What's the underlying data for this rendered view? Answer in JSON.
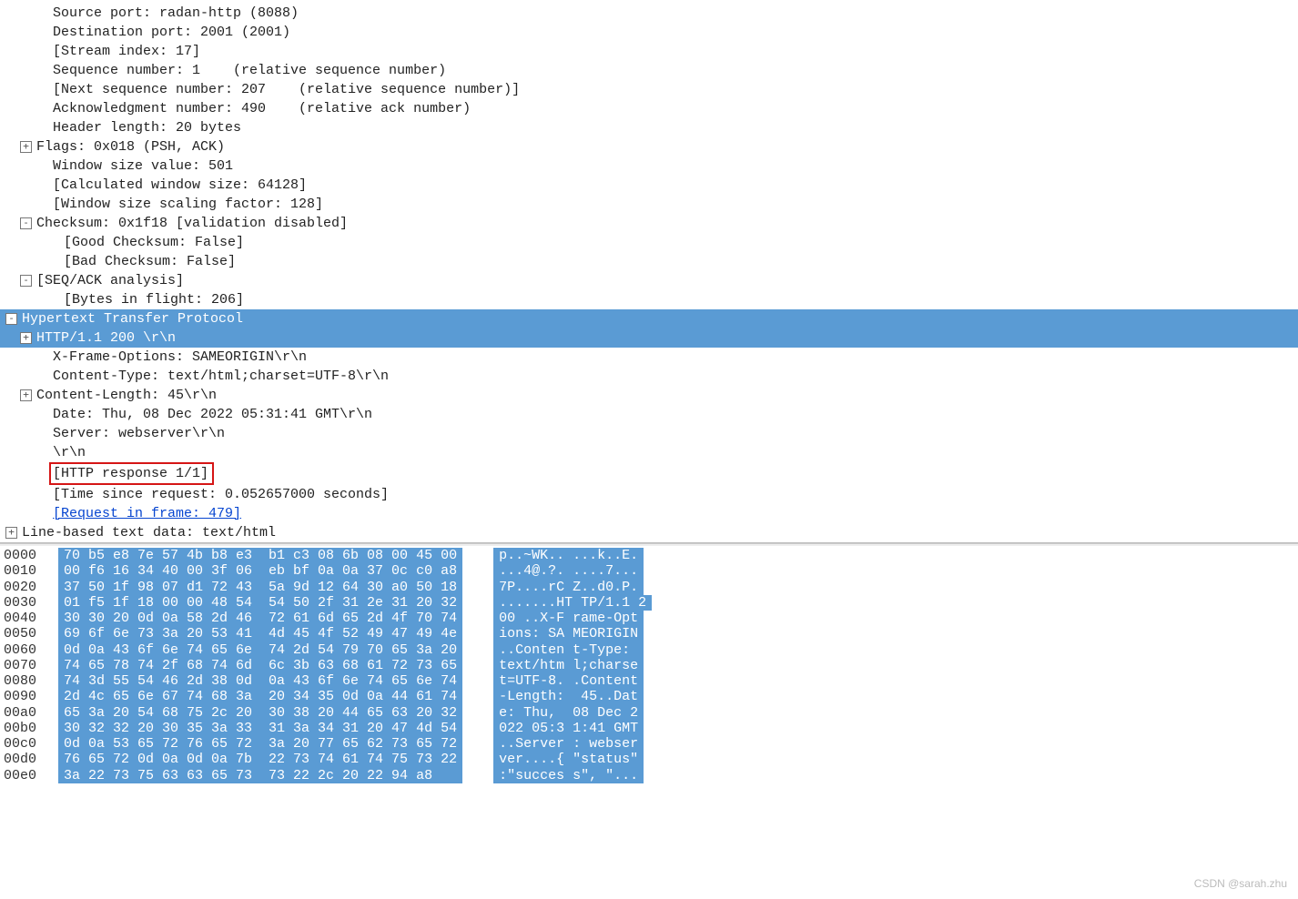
{
  "tcp": {
    "src": "Source port: radan-http (8088)",
    "dst": "Destination port: 2001 (2001)",
    "stream": "[Stream index: 17]",
    "seq": "Sequence number: 1    (relative sequence number)",
    "nseq": "[Next sequence number: 207    (relative sequence number)]",
    "ack": "Acknowledgment number: 490    (relative ack number)",
    "hlen": "Header length: 20 bytes",
    "flags": "Flags: 0x018 (PSH, ACK)",
    "win": "Window size value: 501",
    "cwin": "[Calculated window size: 64128]",
    "sfac": "[Window size scaling factor: 128]",
    "chk": "Checksum: 0x1f18 [validation disabled]",
    "gck": "[Good Checksum: False]",
    "bck": "[Bad Checksum: False]",
    "seqack": "[SEQ/ACK analysis]",
    "bif": "[Bytes in flight: 206]"
  },
  "http": {
    "title": "Hypertext Transfer Protocol",
    "status": "HTTP/1.1 200 \\r\\n",
    "xframe": "X-Frame-Options: SAMEORIGIN\\r\\n",
    "ctype": "Content-Type: text/html;charset=UTF-8\\r\\n",
    "clen": "Content-Length: 45\\r\\n",
    "date": "Date: Thu, 08 Dec 2022 05:31:41 GMT\\r\\n",
    "server": "Server: webserver\\r\\n",
    "crlf": "\\r\\n",
    "resp": "[HTTP response 1/1]",
    "tsr": "[Time since request: 0.052657000 seconds]",
    "reqf": "[Request in frame: 479]"
  },
  "line": "Line-based text data: text/html",
  "hex": [
    {
      "o": "0000",
      "b": "70 b5 e8 7e 57 4b b8 e3  b1 c3 08 6b 08 00 45 00",
      "a": "p..~WK.. ...k..E."
    },
    {
      "o": "0010",
      "b": "00 f6 16 34 40 00 3f 06  eb bf 0a 0a 37 0c c0 a8",
      "a": "...4@.?. ....7..."
    },
    {
      "o": "0020",
      "b": "37 50 1f 98 07 d1 72 43  5a 9d 12 64 30 a0 50 18",
      "a": "7P....rC Z..d0.P."
    },
    {
      "o": "0030",
      "b": "01 f5 1f 18 00 00 48 54  54 50 2f 31 2e 31 20 32",
      "a": ".......HT TP/1.1 2"
    },
    {
      "o": "0040",
      "b": "30 30 20 0d 0a 58 2d 46  72 61 6d 65 2d 4f 70 74",
      "a": "00 ..X-F rame-Opt"
    },
    {
      "o": "0050",
      "b": "69 6f 6e 73 3a 20 53 41  4d 45 4f 52 49 47 49 4e",
      "a": "ions: SA MEORIGIN"
    },
    {
      "o": "0060",
      "b": "0d 0a 43 6f 6e 74 65 6e  74 2d 54 79 70 65 3a 20",
      "a": "..Conten t-Type: "
    },
    {
      "o": "0070",
      "b": "74 65 78 74 2f 68 74 6d  6c 3b 63 68 61 72 73 65",
      "a": "text/htm l;charse"
    },
    {
      "o": "0080",
      "b": "74 3d 55 54 46 2d 38 0d  0a 43 6f 6e 74 65 6e 74",
      "a": "t=UTF-8. .Content"
    },
    {
      "o": "0090",
      "b": "2d 4c 65 6e 67 74 68 3a  20 34 35 0d 0a 44 61 74",
      "a": "-Length:  45..Dat"
    },
    {
      "o": "00a0",
      "b": "65 3a 20 54 68 75 2c 20  30 38 20 44 65 63 20 32",
      "a": "e: Thu,  08 Dec 2"
    },
    {
      "o": "00b0",
      "b": "30 32 32 20 30 35 3a 33  31 3a 34 31 20 47 4d 54",
      "a": "022 05:3 1:41 GMT"
    },
    {
      "o": "00c0",
      "b": "0d 0a 53 65 72 76 65 72  3a 20 77 65 62 73 65 72",
      "a": "..Server : webser"
    },
    {
      "o": "00d0",
      "b": "76 65 72 0d 0a 0d 0a 7b  22 73 74 61 74 75 73 22",
      "a": "ver....{ \"status\""
    },
    {
      "o": "00e0",
      "b": "3a 22 73 75 63 63 65 73  73 22 2c 20 22 94 a8   ",
      "a": ":\"succes s\", \"..."
    }
  ],
  "watermark": "CSDN @sarah.zhu"
}
